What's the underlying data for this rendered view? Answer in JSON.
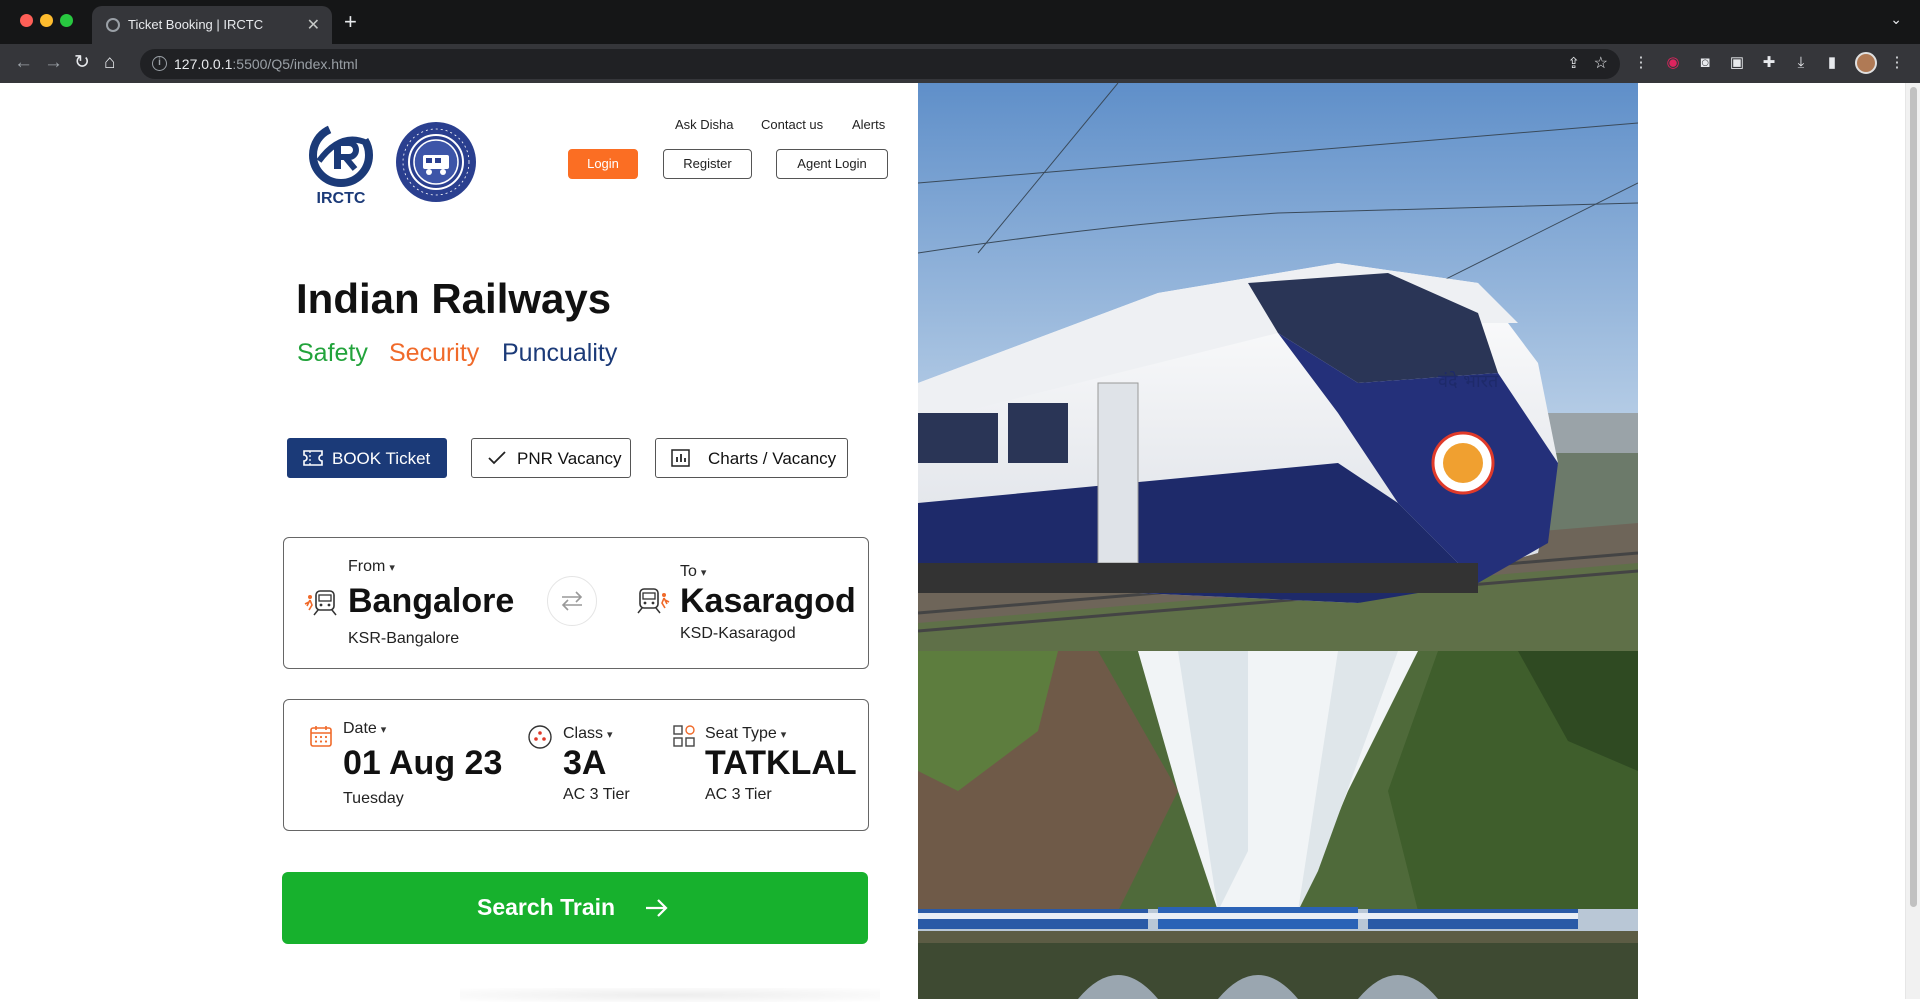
{
  "browser": {
    "tab_title": "Ticket Booking | IRCTC",
    "url_host": "127.0.0.1",
    "url_rest": ":5500/Q5/index.html"
  },
  "header": {
    "links": [
      "Ask Disha",
      "Contact us",
      "Alerts"
    ],
    "login_label": "Login",
    "register_label": "Register",
    "agent_login_label": "Agent Login",
    "logo_irctc_text": "IRCTC"
  },
  "hero": {
    "title": "Indian Railways",
    "tag_safety": "Safety",
    "tag_security": "Security",
    "tag_punctuality": "Puncuality"
  },
  "modes": {
    "book": "BOOK Ticket",
    "pnr": "PNR Vacancy",
    "charts": "Charts / Vacancy"
  },
  "route": {
    "from_label": "From",
    "from_city": "Bangalore",
    "from_code": "KSR-Bangalore",
    "to_label": "To",
    "to_city": "Kasaragod",
    "to_code": "KSD-Kasaragod"
  },
  "details": {
    "date_label": "Date",
    "date_value": "01 Aug 23",
    "date_day": "Tuesday",
    "class_label": "Class",
    "class_value": "3A",
    "class_desc": "AC 3 Tier",
    "seat_label": "Seat Type",
    "seat_value": "TATKLAL",
    "seat_desc": "AC 3 Tier"
  },
  "search_label": "Search Train",
  "colors": {
    "brand_blue": "#1b3a78",
    "accent_orange": "#fb6e23",
    "search_green": "#17b12d",
    "safety_green": "#22a33b",
    "security_orange": "#f06a2a"
  },
  "train_livery_text": "वंदे भारत"
}
